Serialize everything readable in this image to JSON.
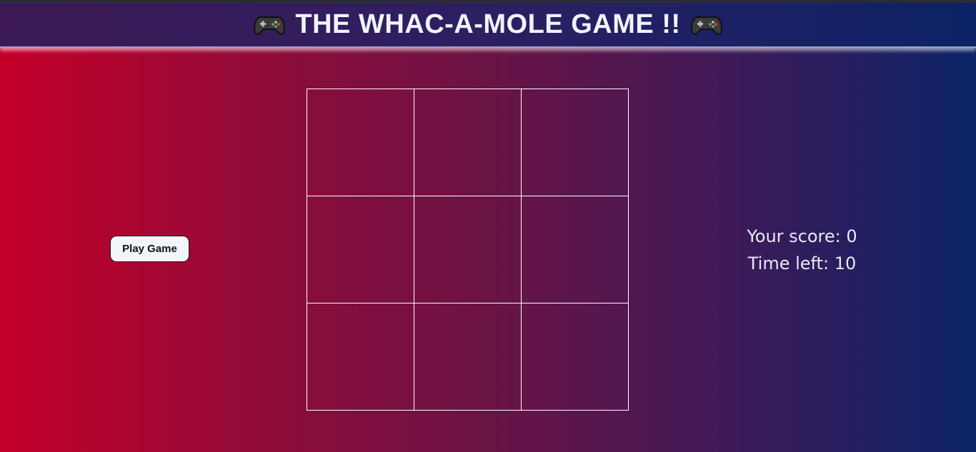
{
  "header": {
    "title": "THE WHAC-A-MOLE GAME !!",
    "left_icon": "gamepad-icon",
    "right_icon": "gamepad-icon"
  },
  "controls": {
    "play_label": "Play Game"
  },
  "board": {
    "rows": 3,
    "cols": 3,
    "cells": [
      "",
      "",
      "",
      "",
      "",
      "",
      "",
      "",
      ""
    ]
  },
  "stats": {
    "score_label": "Your score:",
    "score_value": "0",
    "time_label": "Time left:",
    "time_value": "10"
  },
  "colors": {
    "background_left": "#c4002a",
    "background_right": "#0b2367",
    "header_bg": "#2c1f62",
    "grid_line": "#ffffff",
    "text": "#f1f3fb"
  }
}
